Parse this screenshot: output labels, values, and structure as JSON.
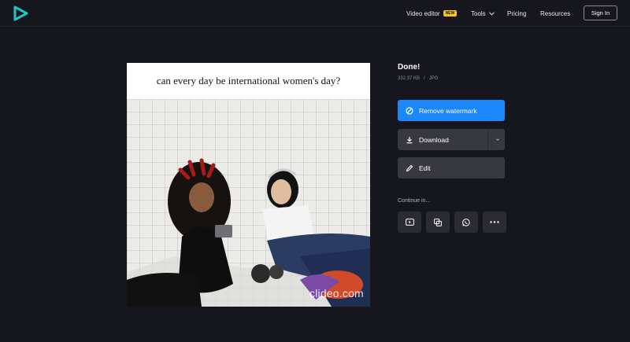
{
  "nav": {
    "video_editor": "Video editor",
    "new_badge": "NEW",
    "tools": "Tools",
    "pricing": "Pricing",
    "resources": "Resources",
    "sign_in": "Sign In"
  },
  "preview": {
    "caption": "can every day be international women's day?",
    "watermark": "clideo.com"
  },
  "result": {
    "title": "Done!",
    "file_size": "332.37 KB",
    "separator": "/",
    "file_type": "JPG"
  },
  "actions": {
    "remove_watermark": "Remove watermark",
    "download": "Download",
    "edit": "Edit"
  },
  "continue": {
    "label": "Continue in...",
    "icons": [
      "video-icon",
      "merge-icon",
      "whatsapp-icon",
      "more-icon"
    ]
  },
  "colors": {
    "background": "#16161e",
    "accent": "#1c87fb",
    "button": "#383840",
    "logo": "#22c3c3",
    "badge": "#f5c518"
  }
}
